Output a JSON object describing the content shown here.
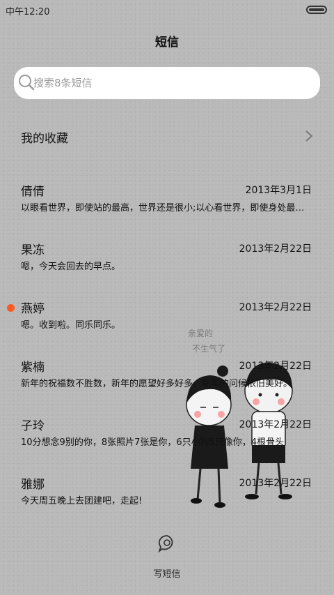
{
  "status_bar": {
    "time": "中午12:20"
  },
  "header": {
    "title": "短信"
  },
  "search": {
    "placeholder": "搜索8条短信",
    "icon": "search-icon"
  },
  "favorites": {
    "label": "我的收藏",
    "icon": "chevron-right-icon"
  },
  "conversations": [
    {
      "name": "倩倩",
      "date": "2013年3月1日",
      "preview": "以眼看世界，即使站的最高，世界还是很小;以心看世界，即使身处最低，世界也是很大。",
      "unread": false
    },
    {
      "name": "果冻",
      "date": "2013年2月22日",
      "preview": "嗯，今天会回去的早点。",
      "unread": false
    },
    {
      "name": "燕婷",
      "date": "2013年2月22日",
      "preview": "嗯。收到啦。同乐同乐。",
      "unread": true
    },
    {
      "name": "紫楠",
      "date": "2013年2月22日",
      "preview": "新年的祝福数不胜数，新年的愿望好多好多，新年的问候依旧美好。",
      "unread": false
    },
    {
      "name": "子玲",
      "date": "2013年2月22日",
      "preview": "10分想念9别的你，8张照片7张是你，6只小狗5只像你，4根骨头",
      "unread": false
    },
    {
      "name": "雅娜",
      "date": "2013年2月22日",
      "preview": "今天周五晚上去团建吧，走起!",
      "unread": false
    }
  ],
  "wallpaper_caption": {
    "line1": "亲爱的",
    "line2": "不生气了"
  },
  "compose": {
    "label": "写短信",
    "icon": "compose-message-icon"
  },
  "colors": {
    "unread_dot": "#ff5a1f",
    "search_bg": "#ffffff",
    "background": "#b9b9b9"
  }
}
